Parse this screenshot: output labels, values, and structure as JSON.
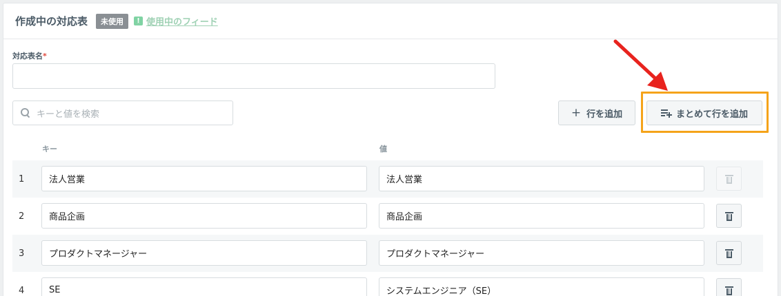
{
  "header": {
    "title": "作成中の対応表",
    "badge": "未使用",
    "feed_link": "使用中のフィード",
    "feed_icon": "!"
  },
  "form": {
    "name_label": "対応表名",
    "required_mark": "*",
    "name_value": ""
  },
  "search": {
    "placeholder": "キーと値を検索"
  },
  "toolbar": {
    "add_row_label": "行を追加",
    "add_row_icon": "+",
    "bulk_add_label": "まとめて行を追加"
  },
  "table": {
    "columns": {
      "key": "キー",
      "value": "値"
    },
    "rows": [
      {
        "num": "1",
        "key": "法人営業",
        "value": "法人営業",
        "delete_enabled": false
      },
      {
        "num": "2",
        "key": "商品企画",
        "value": "商品企画",
        "delete_enabled": true
      },
      {
        "num": "3",
        "key": "プロダクトマネージャー",
        "value": "プロダクトマネージャー",
        "delete_enabled": true
      },
      {
        "num": "4",
        "key": "SE",
        "value": "システムエンジニア（SE）",
        "delete_enabled": true
      }
    ]
  },
  "colors": {
    "highlight": "#f5a31a",
    "arrow": "#e8231e",
    "feed_link": "#9fd1b4",
    "badge": "#8a8f94"
  }
}
